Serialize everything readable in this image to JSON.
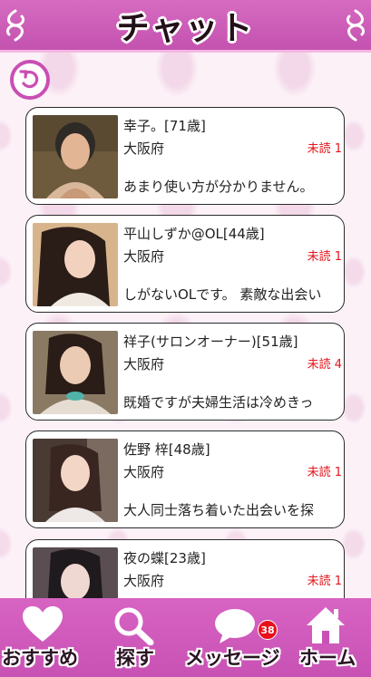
{
  "header": {
    "title": "チャット"
  },
  "back": {
    "icon": "back-arrow-icon"
  },
  "chats": [
    {
      "name": "幸子。[71歳]",
      "prefecture": "大阪府",
      "unread": "未読 1",
      "message": "あまり使い方が分かりません。"
    },
    {
      "name": "平山しずか@OL[44歳]",
      "prefecture": "大阪府",
      "unread": "未読 1",
      "message": "しがないOLです。 素敵な出会い"
    },
    {
      "name": "祥子(サロンオーナー)[51歳]",
      "prefecture": "大阪府",
      "unread": "未読 4",
      "message": "既婚ですが夫婦生活は冷めきっ"
    },
    {
      "name": "佐野 梓[48歳]",
      "prefecture": "大阪府",
      "unread": "未読 1",
      "message": "大人同士落ち着いた出会いを探"
    },
    {
      "name": "夜の蝶[23歳]",
      "prefecture": "大阪府",
      "unread": "未読 1",
      "message": ""
    }
  ],
  "nav": {
    "items": [
      {
        "label": "おすすめ",
        "icon": "heart-icon"
      },
      {
        "label": "探す",
        "icon": "search-icon"
      },
      {
        "label": "メッセージ",
        "icon": "speech-bubble-icon"
      },
      {
        "label": "ホーム",
        "icon": "home-icon"
      }
    ],
    "message_badge": "38"
  },
  "colors": {
    "accent": "#c94fb3",
    "unread": "#e3151b",
    "badge": "#e8101b"
  }
}
